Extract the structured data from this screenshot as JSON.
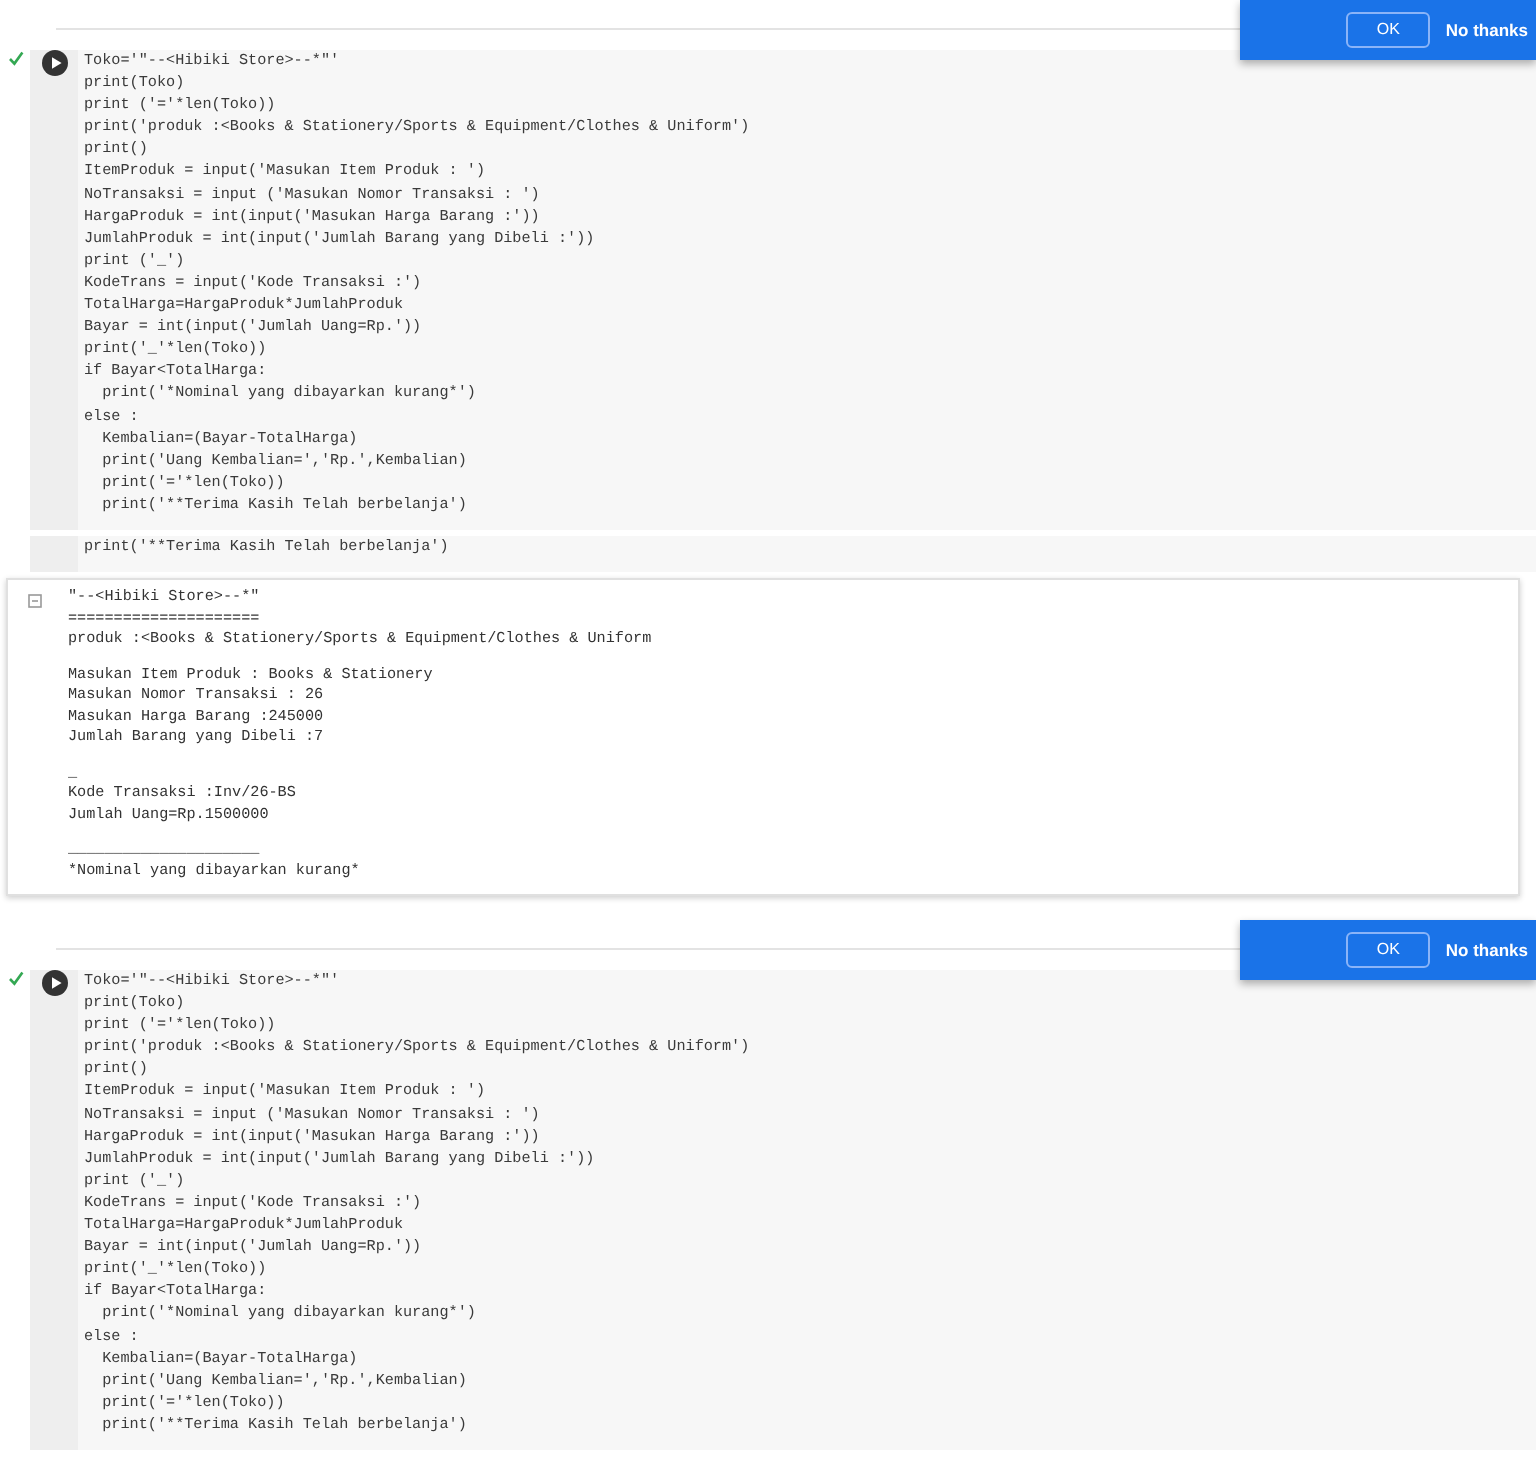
{
  "panels": [
    {
      "kind": "code",
      "lines": [
        "Toko='\"--<Hibiki Store>--*\"'",
        "print(Toko)",
        "print ('='*len(Toko))",
        "print('produk :<Books & Stationery/Sports & Equipment/Clothes & Uniform')",
        "print()",
        "ItemProduk = input('Masukan Item Produk : ')",
        "NoTransaksi = input ('Masukan Nomor Transaksi : ')",
        "HargaProduk = int(input('Masukan Harga Barang :'))",
        "JumlahProduk = int(input('Jumlah Barang yang Dibeli :'))",
        "print ('_')",
        "KodeTrans = input('Kode Transaksi :')",
        "TotalHarga=HargaProduk*JumlahProduk",
        "Bayar = int(input('Jumlah Uang=Rp.'))",
        "print('_'*len(Toko))",
        "if Bayar<TotalHarga:",
        "  print('*Nominal yang dibayarkan kurang*')",
        "else :",
        "  Kembalian=(Bayar-TotalHarga)",
        "  print('Uang Kembalian=','Rp.',Kembalian)",
        "  print('='*len(Toko))",
        "  print('**Terima Kasih Telah berbelanja')"
      ],
      "dialog": {
        "ok": "OK",
        "dismiss": "No thanks"
      }
    },
    {
      "kind": "output",
      "lines": [
        "print('**Terima Kasih Telah berbelanja')"
      ],
      "output_groups": [
        [
          "\"--<Hibiki Store>--*\"",
          "=====================",
          "produk :<Books & Stationery/Sports & Equipment/Clothes & Uniform"
        ],
        [
          "Masukan Item Produk : Books & Stationery",
          "Masukan Nomor Transaksi : 26",
          "Masukan Harga Barang :245000",
          "Jumlah Barang yang Dibeli :7"
        ],
        [
          "_",
          "Kode Transaksi :Inv/26-BS",
          "Jumlah Uang=Rp.1500000"
        ],
        [
          "_____________________",
          "*Nominal yang dibayarkan kurang*"
        ]
      ]
    },
    {
      "kind": "code",
      "lines": [
        "Toko='\"--<Hibiki Store>--*\"'",
        "print(Toko)",
        "print ('='*len(Toko))",
        "print('produk :<Books & Stationery/Sports & Equipment/Clothes & Uniform')",
        "print()",
        "ItemProduk = input('Masukan Item Produk : ')",
        "NoTransaksi = input ('Masukan Nomor Transaksi : ')",
        "HargaProduk = int(input('Masukan Harga Barang :'))",
        "JumlahProduk = int(input('Jumlah Barang yang Dibeli :'))",
        "print ('_')",
        "KodeTrans = input('Kode Transaksi :')",
        "TotalHarga=HargaProduk*JumlahProduk",
        "Bayar = int(input('Jumlah Uang=Rp.'))",
        "print('_'*len(Toko))",
        "if Bayar<TotalHarga:",
        "  print('*Nominal yang dibayarkan kurang*')",
        "else :",
        "  Kembalian=(Bayar-TotalHarga)",
        "  print('Uang Kembalian=','Rp.',Kembalian)",
        "  print('='*len(Toko))",
        "  print('**Terima Kasih Telah berbelanja')"
      ],
      "dialog": {
        "ok": "OK",
        "dismiss": "No thanks"
      }
    }
  ]
}
